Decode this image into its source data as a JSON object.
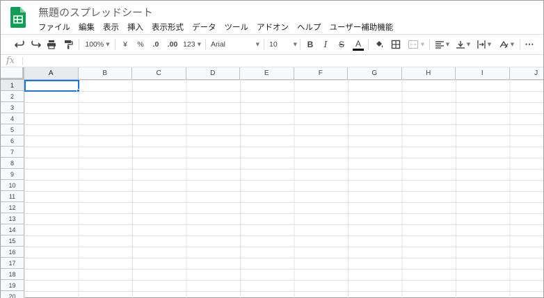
{
  "app": {
    "document_title": "無題のスプレッドシート"
  },
  "menu": [
    "ファイル",
    "編集",
    "表示",
    "挿入",
    "表示形式",
    "データ",
    "ツール",
    "アドオン",
    "ヘルプ",
    "ユーザー補助機能"
  ],
  "toolbar": {
    "zoom": "100%",
    "currency": "¥",
    "percent": "%",
    "decimal_decrease": ".0",
    "decimal_increase": ".00",
    "more_formats": "123",
    "font": "Arial",
    "font_size": "10",
    "bold": "B",
    "italic": "I",
    "strikethrough": "S",
    "text_color_letter": "A",
    "text_color": "#000000",
    "more": "⋯"
  },
  "formula_bar": {
    "label": "fx",
    "value": ""
  },
  "grid": {
    "columns": [
      "A",
      "B",
      "C",
      "D",
      "E",
      "F",
      "G",
      "H",
      "I",
      "J"
    ],
    "rows": [
      "1",
      "2",
      "3",
      "4",
      "5",
      "6",
      "7",
      "8",
      "9",
      "10",
      "11",
      "12",
      "13",
      "14",
      "15",
      "16",
      "17",
      "18",
      "19",
      "20"
    ],
    "selected_cell": "A1",
    "selection_color": "#1a73e8"
  },
  "colors": {
    "brand_green": "#0f9d58",
    "header_bg": "#f8f9fa"
  }
}
